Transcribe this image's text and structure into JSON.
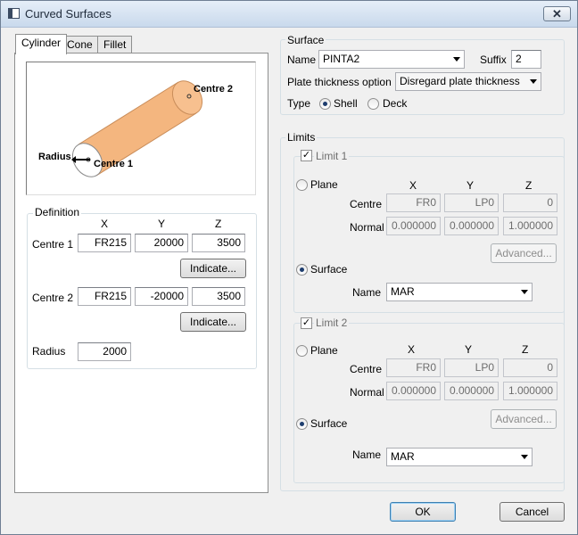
{
  "window": {
    "title": "Curved Surfaces",
    "close_glyph": "✕"
  },
  "tabs": [
    {
      "label": "Cylinder"
    },
    {
      "label": "Cone"
    },
    {
      "label": "Fillet"
    }
  ],
  "diagram": {
    "labels": {
      "centre2": "Centre 2",
      "centre1": "Centre 1",
      "radius": "Radius"
    },
    "colors": {
      "cylinder": "#f4b67f",
      "cylinder_outline": "#c98d5a"
    }
  },
  "definition": {
    "legend": "Definition",
    "col_x": "X",
    "col_y": "Y",
    "col_z": "Z",
    "centre1": {
      "label": "Centre 1",
      "x": "FR215",
      "y": "20000",
      "z": "3500",
      "indicate": "Indicate..."
    },
    "centre2": {
      "label": "Centre 2",
      "x": "FR215",
      "y": "-20000",
      "z": "3500",
      "indicate": "Indicate..."
    },
    "radius": {
      "label": "Radius",
      "value": "2000"
    }
  },
  "surface": {
    "legend": "Surface",
    "name_label": "Name",
    "name_value": "PINTA2",
    "suffix_label": "Suffix",
    "suffix_value": "2",
    "thickness_label": "Plate thickness option",
    "thickness_value": "Disregard plate thickness",
    "type_label": "Type",
    "shell_label": "Shell",
    "deck_label": "Deck",
    "selected_type": "Shell"
  },
  "limits": {
    "legend": "Limits",
    "limit1": {
      "label": "Limit 1",
      "checked": true,
      "plane_label": "Plane",
      "col_x": "X",
      "col_y": "Y",
      "col_z": "Z",
      "centre_label": "Centre",
      "centre": [
        "FR0",
        "LP0",
        "0"
      ],
      "normal_label": "Normal",
      "normal": [
        "0.000000",
        "0.000000",
        "1.000000"
      ],
      "advanced": "Advanced...",
      "surface_label": "Surface",
      "selected": "Surface",
      "name_label": "Name",
      "name_value": "MAR"
    },
    "limit2": {
      "label": "Limit 2",
      "checked": true,
      "plane_label": "Plane",
      "col_x": "X",
      "col_y": "Y",
      "col_z": "Z",
      "centre_label": "Centre",
      "centre": [
        "FR0",
        "LP0",
        "0"
      ],
      "normal_label": "Normal",
      "normal": [
        "0.000000",
        "0.000000",
        "1.000000"
      ],
      "advanced": "Advanced...",
      "surface_label": "Surface",
      "selected": "Surface",
      "name_label": "Name",
      "name_value": "MAR"
    }
  },
  "buttons": {
    "ok": "OK",
    "cancel": "Cancel"
  }
}
